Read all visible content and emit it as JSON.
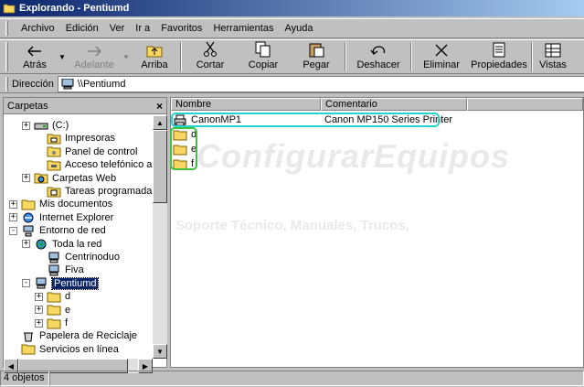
{
  "window": {
    "title": "Explorando - Pentiumd"
  },
  "menu": [
    {
      "label": "Archivo"
    },
    {
      "label": "Edición"
    },
    {
      "label": "Ver"
    },
    {
      "label": "Ir a"
    },
    {
      "label": "Favoritos"
    },
    {
      "label": "Herramientas"
    },
    {
      "label": "Ayuda"
    }
  ],
  "toolbar": {
    "back": "Atrás",
    "forward": "Adelante",
    "up": "Arriba",
    "cut": "Cortar",
    "copy": "Copiar",
    "paste": "Pegar",
    "undo": "Deshacer",
    "delete": "Eliminar",
    "properties": "Propiedades",
    "views": "Vistas"
  },
  "address": {
    "label": "Dirección",
    "value": "\\\\Pentiumd"
  },
  "folders_pane": {
    "title": "Carpetas",
    "close": "×"
  },
  "tree": [
    {
      "label": "(C:)",
      "icon": "drive-icon"
    },
    {
      "label": "Impresoras",
      "icon": "printers-folder-icon"
    },
    {
      "label": "Panel de control",
      "icon": "control-panel-icon"
    },
    {
      "label": "Acceso telefónico a redes",
      "icon": "dialup-icon"
    },
    {
      "label": "Carpetas Web",
      "icon": "web-folders-icon"
    },
    {
      "label": "Tareas programadas",
      "icon": "scheduled-tasks-icon"
    },
    {
      "label": "Mis documentos",
      "icon": "folder-icon"
    },
    {
      "label": "Internet Explorer",
      "icon": "ie-icon"
    },
    {
      "label": "Entorno de red",
      "icon": "network-icon"
    },
    {
      "label": "Toda la red",
      "icon": "globe-icon"
    },
    {
      "label": "Centrinoduo",
      "icon": "computer-icon"
    },
    {
      "label": "Fiva",
      "icon": "computer-icon"
    },
    {
      "label": "Pentiumd",
      "icon": "computer-icon"
    },
    {
      "label": "d",
      "icon": "folder-icon"
    },
    {
      "label": "e",
      "icon": "folder-icon"
    },
    {
      "label": "f",
      "icon": "folder-icon"
    },
    {
      "label": "Papelera de Reciclaje",
      "icon": "recycle-bin-icon"
    },
    {
      "label": "Servicios en línea",
      "icon": "folder-icon"
    }
  ],
  "list": {
    "columns": [
      "Nombre",
      "Comentario"
    ],
    "items": [
      {
        "name": "CanonMP1",
        "comment": "Canon MP150 Series Printer",
        "icon": "printer-icon"
      },
      {
        "name": "d",
        "comment": "",
        "icon": "folder-icon"
      },
      {
        "name": "e",
        "comment": "",
        "icon": "folder-icon"
      },
      {
        "name": "f",
        "comment": "",
        "icon": "folder-icon"
      }
    ]
  },
  "watermark": {
    "title": "ConfigurarEquipos",
    "tagline": "Soporte Técnico, Manuales, Trucos,"
  },
  "status": {
    "count": "4 objetos"
  },
  "colors": {
    "titlebar": "#0a246a",
    "selection": "#0a246a",
    "highlight_printer": "#22d3d3",
    "highlight_folders": "#3ec33e"
  }
}
